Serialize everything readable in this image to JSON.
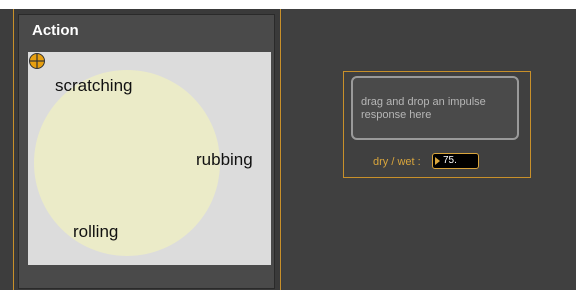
{
  "action_panel": {
    "title": "Action",
    "labels": {
      "scratching": "scratching",
      "rubbing": "rubbing",
      "rolling": "rolling"
    }
  },
  "impulse_response": {
    "drop_text": "drag and drop an impulse response here",
    "dry_wet_label": "dry / wet :",
    "dry_wet_value": "75."
  },
  "colors": {
    "accent": "#c8902a",
    "circle_fill": "#ebebc8",
    "canvas_bg": "#dcdcdc",
    "cursor": "#e8a010"
  },
  "icons": {
    "cursor": "crosshair-icon",
    "dry_wet_arrow": "triangle-right-icon"
  }
}
